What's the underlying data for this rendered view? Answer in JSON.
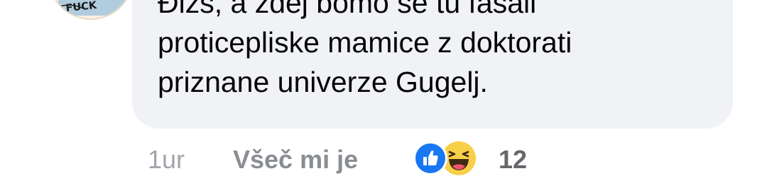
{
  "comment": {
    "text": "Đizs, a zdej bomo se tu fasali\nproticepliske mamice z doktorati\npriznane univerze Gugelj.",
    "avatar_text": "FUCK"
  },
  "actions": {
    "timestamp": "1ur",
    "like_label": "Všeč mi je",
    "reaction_count": "12",
    "reaction_icons": [
      "like-icon",
      "haha-icon"
    ]
  },
  "colors": {
    "bubble": "#f0f2f5",
    "like_blue": "#1877f2",
    "haha_yellow": "#f7d048",
    "muted_text": "#8a8d91"
  }
}
